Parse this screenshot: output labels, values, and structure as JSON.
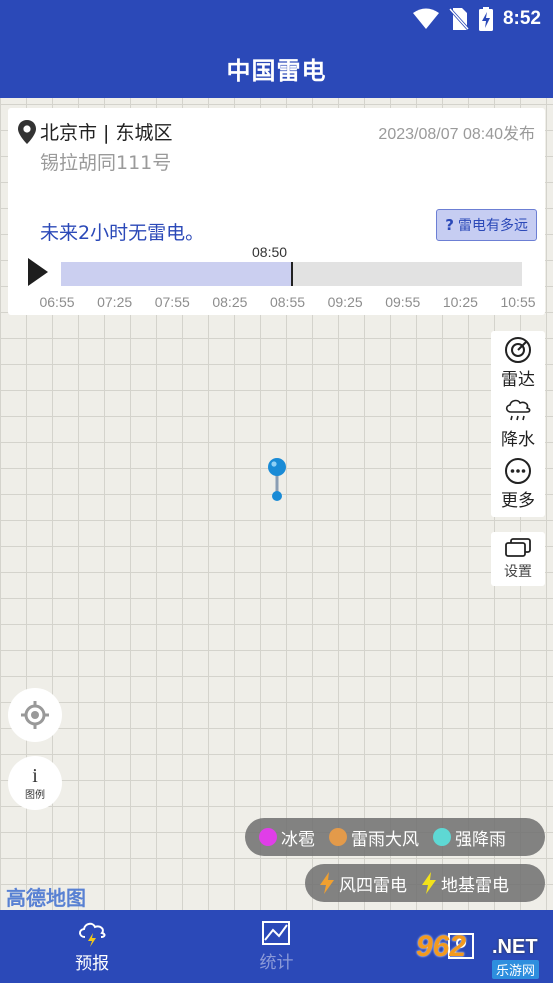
{
  "status_bar": {
    "time": "8:52"
  },
  "app_bar": {
    "title": "中国雷电"
  },
  "info_card": {
    "location": "北京市 | 东城区",
    "published": "2023/08/07 08:40发布",
    "street": "锡拉胡同111号",
    "forecast": "未来2小时无雷电。",
    "distance_button": {
      "icon": "?",
      "label": "雷电有多远"
    },
    "timeline": {
      "current_label": "08:50",
      "progress_fraction": 0.5,
      "ticks": [
        "06:55",
        "07:25",
        "07:55",
        "08:25",
        "08:55",
        "09:25",
        "09:55",
        "10:25",
        "10:55"
      ]
    }
  },
  "layers": [
    {
      "label": "雷达",
      "icon": "radar-icon"
    },
    {
      "label": "降水",
      "icon": "rain-cloud-icon"
    },
    {
      "label": "更多",
      "icon": "more-icon"
    }
  ],
  "settings": {
    "label": "设置"
  },
  "legend_button": {
    "icon": "i",
    "label": "图例"
  },
  "legend": {
    "row1": [
      {
        "label": "冰雹",
        "color": "#e03ee8"
      },
      {
        "label": "雷雨大风",
        "color": "#e39a4a"
      },
      {
        "label": "强降雨",
        "color": "#5ed8d4"
      }
    ],
    "row2": [
      {
        "label": "风四雷电",
        "color": "#f0a030"
      },
      {
        "label": "地基雷电",
        "color": "#f3e21a"
      }
    ]
  },
  "map": {
    "provider_logo": "高德地图"
  },
  "bottom_nav": [
    {
      "label": "预报",
      "active": true
    },
    {
      "label": "统计",
      "active": false
    },
    {
      "label": "",
      "active": false
    }
  ],
  "watermark": {
    "number": "962",
    "net": ".NET",
    "sub": "乐游网"
  },
  "colors": {
    "brand": "#2b49b8"
  }
}
